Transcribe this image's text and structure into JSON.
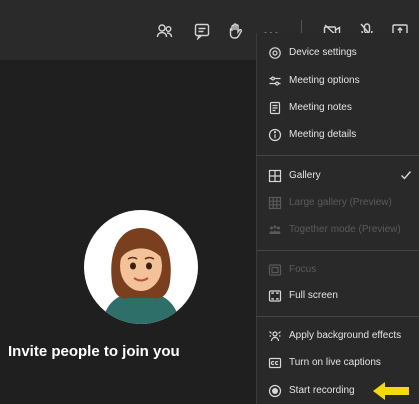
{
  "toolbar": {
    "icons": [
      "participants-icon",
      "chat-icon",
      "raise-hand-icon",
      "more-options-icon",
      "camera-off-icon",
      "mic-off-icon",
      "share-screen-icon"
    ]
  },
  "menu": {
    "device_settings": "Device settings",
    "meeting_options": "Meeting options",
    "meeting_notes": "Meeting notes",
    "meeting_details": "Meeting details",
    "gallery": "Gallery",
    "large_gallery": "Large gallery (Preview)",
    "together_mode": "Together mode (Preview)",
    "focus": "Focus",
    "full_screen": "Full screen",
    "apply_background": "Apply background effects",
    "live_captions": "Turn on live captions",
    "start_recording": "Start recording"
  },
  "stage": {
    "invite_text": "Invite people to join you"
  },
  "colors": {
    "background": "#1f1f1f",
    "toolbar": "#2a2a2a",
    "menu_bg": "#292929",
    "annotation_arrow": "#f5d90a"
  }
}
